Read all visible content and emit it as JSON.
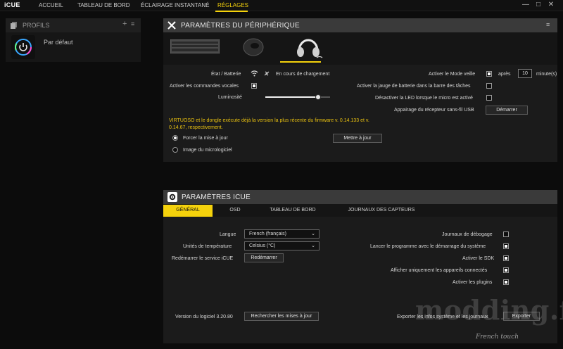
{
  "app": {
    "name": "iCUE"
  },
  "nav": {
    "items": [
      {
        "label": "ACCUEIL",
        "active": false
      },
      {
        "label": "TABLEAU DE BORD",
        "active": false
      },
      {
        "label": "ÉCLAIRAGE INSTANTANÉ",
        "active": false
      },
      {
        "label": "RÉGLAGES",
        "active": true
      }
    ],
    "window_controls": [
      "—",
      "□",
      "✕"
    ]
  },
  "sidebar": {
    "title": "PROFILS",
    "add": "+",
    "menu": "≡",
    "profile": {
      "name": "Par défaut"
    }
  },
  "device_panel": {
    "title": "PARAMÈTRES DU PÉRIPHÉRIQUE",
    "battery_label": "État / Batterie",
    "battery_status": "En cours de chargement",
    "voice_commands_label": "Activer les commandes vocales",
    "voice_commands_on": true,
    "brightness_label": "Luminosité",
    "brightness_value": 0.82,
    "sleep_mode_label": "Activer le Mode veille",
    "sleep_mode_on": true,
    "sleep_after_label": "après",
    "sleep_after_value": "10",
    "sleep_after_unit": "minute(s)",
    "battery_gauge_label": "Activer la jauge de batterie dans la barre des tâches",
    "led_off_label": "Désactiver la LED lorsque le micro est activé",
    "pairing_label": "Appairage du récepteur sans-fil USB",
    "pairing_button": "Démarrer",
    "firmware_message": "VIRTUOSO et le dongle exécute déjà la version la plus récente du firmware v. 0.14.133 et v. 0.14.67, respectivement.",
    "force_update_label": "Forcer la mise à jour",
    "firmware_image_label": "Image du micrologiciel",
    "update_button": "Mettre à jour"
  },
  "icue_panel": {
    "title": "PARAMÈTRES ICUE",
    "tabs": [
      {
        "label": "GÉNÉRAL",
        "active": true
      },
      {
        "label": "OSD",
        "active": false
      },
      {
        "label": "TABLEAU DE BORD",
        "active": false
      },
      {
        "label": "JOURNAUX DES CAPTEURS",
        "active": false
      }
    ],
    "language_label": "Langue",
    "language_value": "French (français)",
    "temp_label": "Unités de température",
    "temp_value": "Celsius (°C)",
    "restart_label": "Redémarrer le service iCUE",
    "restart_button": "Redémarrer",
    "debug_logs_label": "Journaux de débogage",
    "debug_logs_on": false,
    "launch_startup_label": "Lancer le programme avec le démarrage du système",
    "launch_startup_on": true,
    "sdk_label": "Activer le SDK",
    "sdk_on": true,
    "connected_only_label": "Afficher uniquement les appareils connectés",
    "connected_only_on": true,
    "plugins_label": "Activer les plugins",
    "plugins_on": true,
    "version_label": "Version du logiciel 3.20.80",
    "check_updates_button": "Rechercher les mises à jour",
    "export_label": "Exporter les infos système et les journaux",
    "export_button": "Exporter"
  },
  "watermark": {
    "text": "modding.fr",
    "tagline": "French touch"
  },
  "colors": {
    "accent": "#f5d20c",
    "panel": "#1b1b1b",
    "header": "#3a3a3a",
    "background": "#0c0c0c"
  }
}
